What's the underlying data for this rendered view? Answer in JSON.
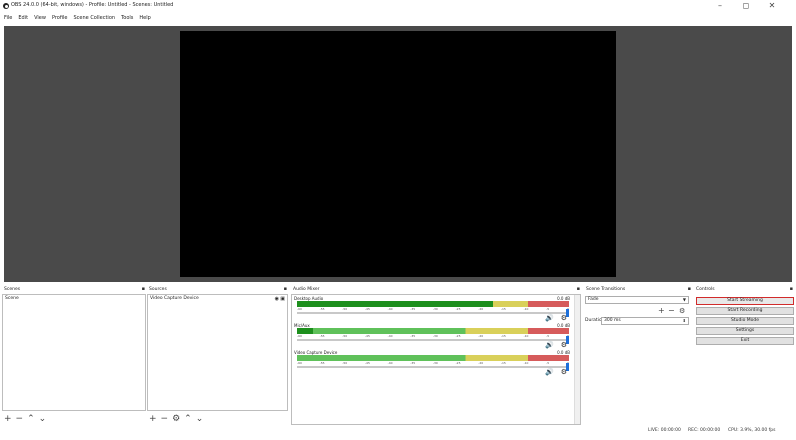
{
  "window": {
    "title": "OBS 24.0.0 (64-bit, windows) - Profile: Untitled - Scenes: Untitled",
    "minimize": "–",
    "maximize": "◻",
    "close": "✕"
  },
  "menu": [
    "File",
    "Edit",
    "View",
    "Profile",
    "Scene Collection",
    "Tools",
    "Help"
  ],
  "scenes": {
    "header": "Scenes",
    "items": [
      "Scene"
    ],
    "toolbar": {
      "add": "+",
      "remove": "−",
      "up": "⌃",
      "down": "⌄"
    }
  },
  "sources": {
    "header": "Sources",
    "items": [
      "Video Capture Device"
    ],
    "toolbar": {
      "add": "+",
      "remove": "−",
      "settings": "⚙",
      "up": "⌃",
      "down": "⌄"
    }
  },
  "mixer": {
    "header": "Audio Mixer",
    "ticks": [
      "-60",
      "-55",
      "-50",
      "-45",
      "-40",
      "-35",
      "-30",
      "-25",
      "-20",
      "-15",
      "-10",
      "-5",
      "0"
    ],
    "tracks": [
      {
        "name": "Desktop Audio",
        "db": "0.0 dB",
        "level": 0.72
      },
      {
        "name": "Mic/Aux",
        "db": "0.0 dB",
        "level": 0.06
      },
      {
        "name": "Video Capture Device",
        "db": "0.0 dB",
        "level": 0.0
      }
    ]
  },
  "transitions": {
    "header": "Scene Transitions",
    "selected": "Fade",
    "duration_label": "Duration",
    "duration_value": "300 ms",
    "add": "+",
    "remove": "−"
  },
  "controls": {
    "header": "Controls",
    "start_streaming": "Start Streaming",
    "start_recording": "Start Recording",
    "studio_mode": "Studio Mode",
    "settings": "Settings",
    "exit": "Exit"
  },
  "status": {
    "live": "LIVE: 00:00:00",
    "rec": "REC: 00:00:00",
    "cpu": "CPU: 3.9%, 30.00 fps"
  },
  "colors": {
    "preview_bg": "#4a4a4a",
    "canvas": "#000000",
    "highlight": "#d12b2b",
    "meter_green": "#5fc15a",
    "meter_yellow": "#d9d05a",
    "meter_red": "#d65b5b",
    "slider_handle": "#1e6fd9"
  }
}
